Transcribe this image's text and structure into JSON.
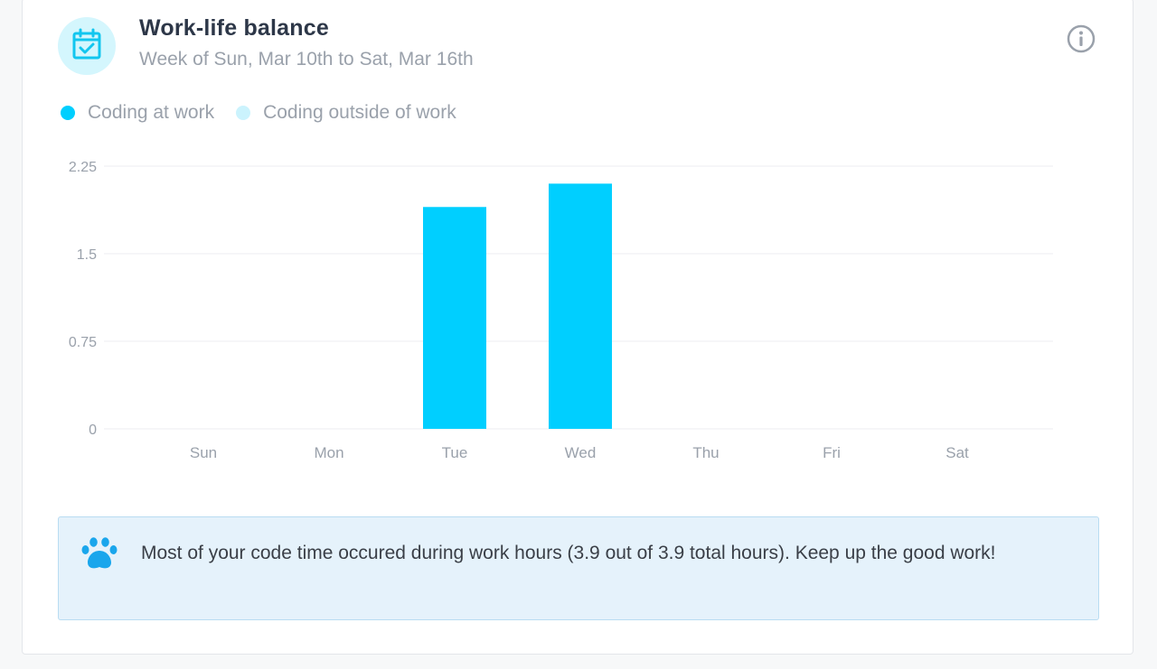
{
  "card": {
    "title": "Work-life balance",
    "subtitle": "Week of Sun, Mar 10th to Sat, Mar 16th",
    "header_icon": "calendar-check-icon",
    "info_icon": "info-icon"
  },
  "colors": {
    "work": "#00cfff",
    "outside": "#cbf3fd",
    "icon_bg": "#d4f6fd",
    "icon": "#12c6ef",
    "notice_bg": "#e5f2fb",
    "notice_border": "#b9dcf2",
    "paw": "#1aa6ec"
  },
  "legend": [
    {
      "label": "Coding at work",
      "color": "#00cfff"
    },
    {
      "label": "Coding outside of work",
      "color": "#cbf3fd"
    }
  ],
  "chart_data": {
    "type": "bar",
    "categories": [
      "Sun",
      "Mon",
      "Tue",
      "Wed",
      "Thu",
      "Fri",
      "Sat"
    ],
    "series": [
      {
        "name": "Coding at work",
        "values": [
          0,
          0,
          1.9,
          2.1,
          0,
          0,
          0
        ]
      },
      {
        "name": "Coding outside of work",
        "values": [
          0,
          0,
          0,
          0,
          0,
          0,
          0
        ]
      }
    ],
    "yticks": [
      "0",
      "0.75",
      "1.5",
      "2.25"
    ],
    "ylim": [
      0,
      2.25
    ],
    "grid": true,
    "stacked": true
  },
  "notice": {
    "icon": "paw-icon",
    "text": "Most of your code time occured during work hours (3.9 out of 3.9 total hours). Keep up the good work!"
  }
}
